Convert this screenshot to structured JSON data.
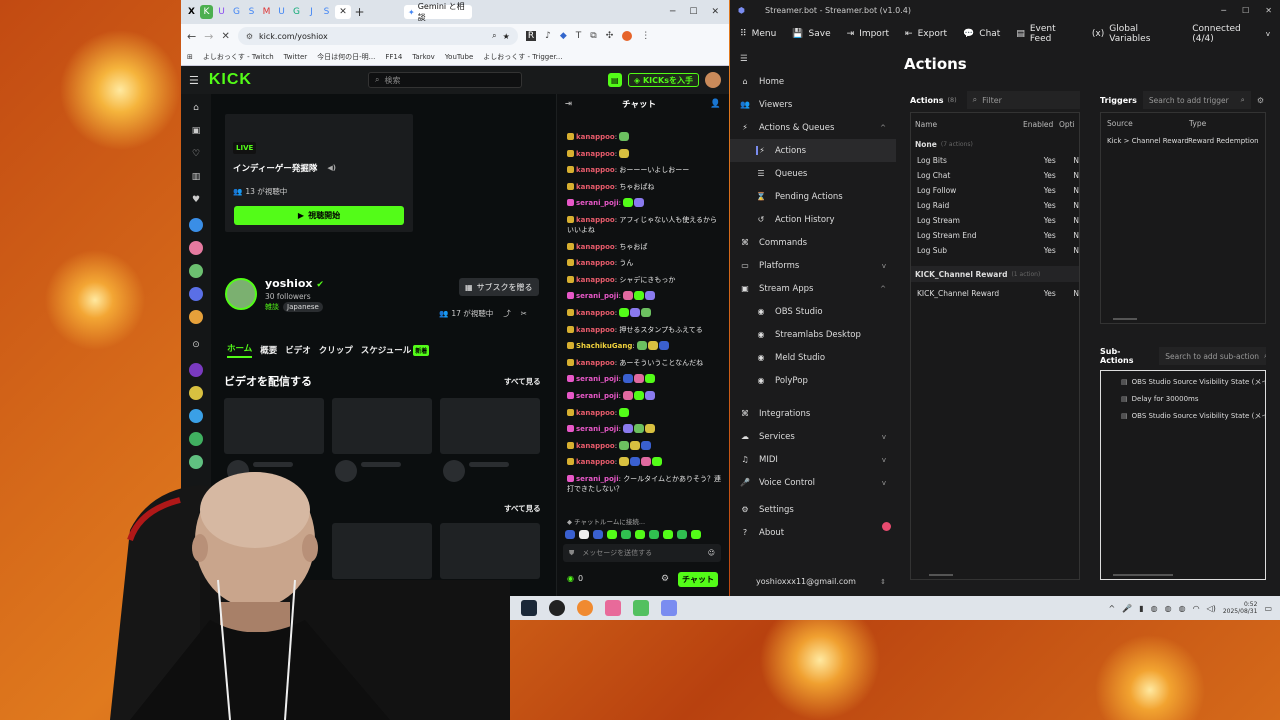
{
  "browser": {
    "tab_gemini": "Gemini と相談",
    "url": "kick.com/yoshiox",
    "bookmarks": [
      "よしおっくす - Twitch",
      "Twitter",
      "今日は何の日-明...",
      "FF14",
      "Tarkov",
      "YouTube",
      "よしおっくす - Trigger..."
    ]
  },
  "kick": {
    "logo": "KICK",
    "search_placeholder": "検索",
    "kicks_button": "KICKsを入手",
    "live_badge": "LIVE",
    "stream_title": "インディーゲー発掘隊",
    "viewers": "13 が視聴中",
    "start_watch": "視聴開始",
    "channel": {
      "name": "yoshiox",
      "followers": "30 followers",
      "category": "雑談",
      "language": "Japanese",
      "subscribe": "サブスクを贈る",
      "watching": "17 が視聴中"
    },
    "tabs": [
      "ホーム",
      "概要",
      "ビデオ",
      "クリップ",
      "スケジュール"
    ],
    "tab_new_badge": "新着",
    "section_title": "ビデオを配信する",
    "see_all": "すべて見る",
    "see_all2": "すべて見る"
  },
  "chat": {
    "title": "チャット",
    "messages": [
      {
        "user": "kanappoo",
        "color": "#e85b6b",
        "text": "",
        "emotes": 1
      },
      {
        "user": "kanappoo",
        "color": "#e85b6b",
        "text": "",
        "emotes": 1
      },
      {
        "user": "kanappoo",
        "color": "#e85b6b",
        "text": "おーーーいよしおーー",
        "emotes": 0
      },
      {
        "user": "kanappoo",
        "color": "#e85b6b",
        "text": "ちゃおぱね",
        "emotes": 0
      },
      {
        "user": "serani_poji",
        "color": "#e858c8",
        "text": "",
        "emotes": 2
      },
      {
        "user": "kanappoo",
        "color": "#e85b6b",
        "text": "アフィじゃない人も使えるからいいよね",
        "emotes": 0
      },
      {
        "user": "kanappoo",
        "color": "#e85b6b",
        "text": "ちゃおぱ",
        "emotes": 0
      },
      {
        "user": "kanappoo",
        "color": "#e85b6b",
        "text": "うん",
        "emotes": 0
      },
      {
        "user": "kanappoo",
        "color": "#e85b6b",
        "text": "シャデにきもっか",
        "emotes": 0
      },
      {
        "user": "serani_poji",
        "color": "#e858c8",
        "text": "",
        "emotes": 3
      },
      {
        "user": "kanappoo",
        "color": "#e85b6b",
        "text": "",
        "emotes": 3
      },
      {
        "user": "kanappoo",
        "color": "#e85b6b",
        "text": "押せるスタンプもふえてる",
        "emotes": 0
      },
      {
        "user": "ShachikuGang",
        "color": "#f0d23c",
        "text": "",
        "emotes": 3
      },
      {
        "user": "kanappoo",
        "color": "#e85b6b",
        "text": "あーそういうことなんだね",
        "emotes": 0
      },
      {
        "user": "serani_poji",
        "color": "#e858c8",
        "text": "",
        "emotes": 3
      },
      {
        "user": "serani_poji",
        "color": "#e858c8",
        "text": "",
        "emotes": 3
      },
      {
        "user": "kanappoo",
        "color": "#e85b6b",
        "text": "",
        "emotes": 1
      },
      {
        "user": "serani_poji",
        "color": "#e858c8",
        "text": "",
        "emotes": 3
      },
      {
        "user": "kanappoo",
        "color": "#e85b6b",
        "text": "",
        "emotes": 3
      },
      {
        "user": "kanappoo",
        "color": "#e85b6b",
        "text": "",
        "emotes": 4
      },
      {
        "user": "serani_poji",
        "color": "#e858c8",
        "text": "クールタイムとかありそう？連打できたしない？",
        "emotes": 0
      }
    ],
    "joined": "チャットルームに接続...",
    "input_placeholder": "メッセージを送信する",
    "points": "0",
    "send": "チャット"
  },
  "sb": {
    "title": "Streamer.bot - Streamer.bot (v1.0.4)",
    "menu": [
      "Menu",
      "Save",
      "Import",
      "Export",
      "Chat",
      "Event Feed",
      "Global Variables"
    ],
    "connected": "Connected (4/4)",
    "page_title": "Actions",
    "nav": [
      {
        "label": "Home",
        "sub": false,
        "chev": "",
        "active": false
      },
      {
        "label": "Viewers",
        "sub": false,
        "chev": "",
        "active": false
      },
      {
        "label": "Actions & Queues",
        "sub": false,
        "chev": "^",
        "active": false
      },
      {
        "label": "Actions",
        "sub": true,
        "chev": "",
        "active": true
      },
      {
        "label": "Queues",
        "sub": true,
        "chev": "",
        "active": false
      },
      {
        "label": "Pending Actions",
        "sub": true,
        "chev": "",
        "active": false
      },
      {
        "label": "Action History",
        "sub": true,
        "chev": "",
        "active": false
      },
      {
        "label": "Commands",
        "sub": false,
        "chev": "",
        "active": false
      },
      {
        "label": "Platforms",
        "sub": false,
        "chev": "v",
        "active": false
      },
      {
        "label": "Stream Apps",
        "sub": false,
        "chev": "^",
        "active": false
      },
      {
        "label": "OBS Studio",
        "sub": true,
        "chev": "",
        "active": false
      },
      {
        "label": "Streamlabs Desktop",
        "sub": true,
        "chev": "",
        "active": false
      },
      {
        "label": "Meld Studio",
        "sub": true,
        "chev": "",
        "active": false
      },
      {
        "label": "PolyPop",
        "sub": true,
        "chev": "",
        "active": false
      },
      {
        "label": "Integrations",
        "sub": false,
        "chev": "",
        "active": false
      },
      {
        "label": "Services",
        "sub": false,
        "chev": "v",
        "active": false
      },
      {
        "label": "MIDI",
        "sub": false,
        "chev": "v",
        "active": false
      },
      {
        "label": "Voice Control",
        "sub": false,
        "chev": "v",
        "active": false
      },
      {
        "label": "Settings",
        "sub": false,
        "chev": "",
        "active": false
      },
      {
        "label": "About",
        "sub": false,
        "chev": "",
        "active": false
      }
    ],
    "account": "yoshioxxx11@gmail.com",
    "actions": {
      "label": "Actions",
      "count": "(8)",
      "filter_placeholder": "Filter",
      "cols": [
        "Name",
        "Enabled",
        "Opti"
      ],
      "group1": "None",
      "group1_count": "(7 actions)",
      "rows1": [
        [
          "Log Bits",
          "Yes",
          "N"
        ],
        [
          "Log Chat",
          "Yes",
          "N"
        ],
        [
          "Log Follow",
          "Yes",
          "N"
        ],
        [
          "Log Raid",
          "Yes",
          "N"
        ],
        [
          "Log Stream",
          "Yes",
          "N"
        ],
        [
          "Log Stream End",
          "Yes",
          "N"
        ],
        [
          "Log Sub",
          "Yes",
          "N"
        ]
      ],
      "group2": "KICK_Channel Reward",
      "group2_count": "(1 action)",
      "rows2": [
        [
          "KICK_Channel Reward",
          "Yes",
          "N"
        ]
      ]
    },
    "triggers": {
      "label": "Triggers",
      "search_placeholder": "Search to add trigger",
      "cols": [
        "Source",
        "Type"
      ],
      "rows": [
        [
          "Kick > Channel Reward",
          "Reward Redemption"
        ]
      ]
    },
    "subactions": {
      "label": "Sub-Actions",
      "search_placeholder": "Search to add sub-action",
      "rows": [
        "OBS Studio Source Visibility State (メイン",
        "Delay for 30000ms",
        "OBS Studio Source Visibility State (メイン"
      ]
    }
  },
  "taskbar": {
    "time": "0:52",
    "date": "2025/08/31"
  },
  "colors": {
    "kick_green": "#53fc18",
    "sb_bg": "#1b1b1c",
    "settings_dot": "#e84b6f"
  }
}
